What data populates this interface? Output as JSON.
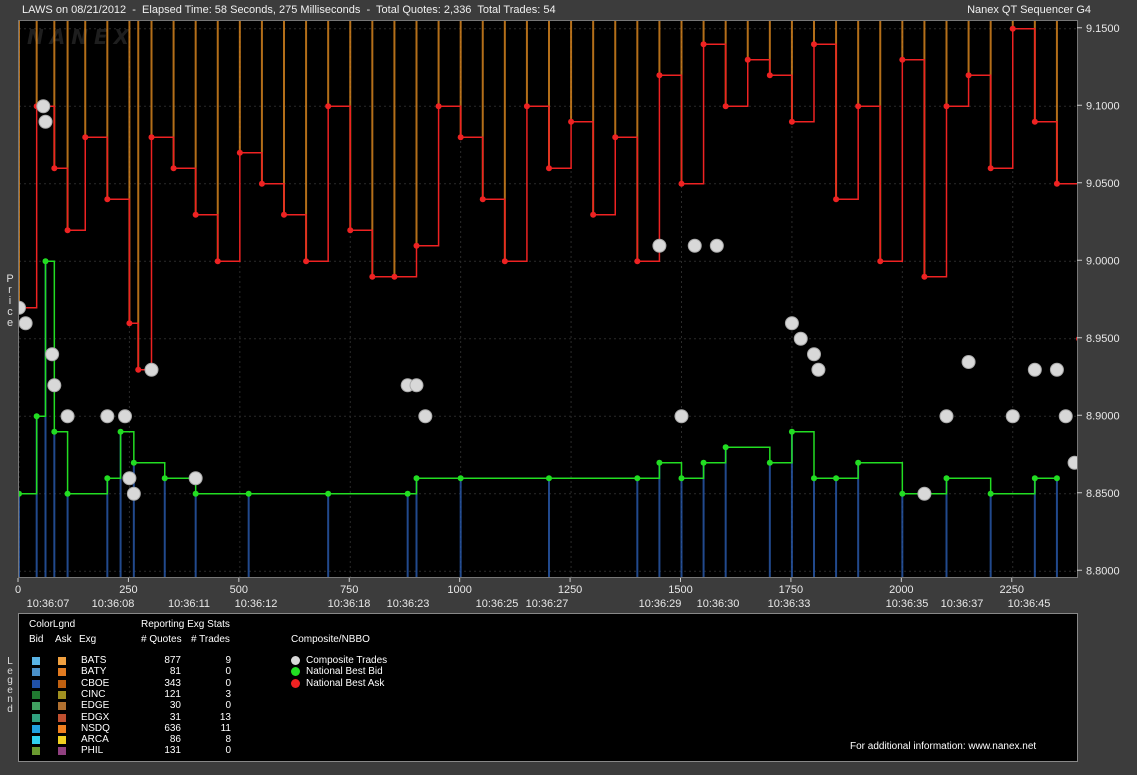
{
  "header": {
    "left": "LAWS on 08/21/2012  -  Elapsed Time: 58 Seconds, 275 Milliseconds  -  Total Quotes: 2,336  Total Trades: 54",
    "right": "Nanex QT Sequencer G4",
    "watermark": "NANEX"
  },
  "axis": {
    "vertical_label": "Price",
    "price_ticks": [
      "9.1500",
      "9.1000",
      "9.0500",
      "9.0000",
      "8.9500",
      "8.9000",
      "8.8500",
      "8.8000"
    ],
    "seq_ticks": [
      "0",
      "250",
      "500",
      "750",
      "1000",
      "1250",
      "1500",
      "1750",
      "2000",
      "2250"
    ],
    "time_ticks": [
      "10:36:07",
      "10:36:08",
      "10:36:11",
      "10:36:12",
      "10:36:18",
      "10:36:23",
      "10:36:25",
      "10:36:27",
      "10:36:29",
      "10:36:30",
      "10:36:33",
      "10:36:35",
      "10:36:37",
      "10:36:45"
    ]
  },
  "legend": {
    "vertical_label": "Legend",
    "color_legend_title": "ColorLgnd",
    "col_bid": "Bid",
    "col_ask": "Ask",
    "col_exg": "Exg",
    "stats_title": "Reporting Exg Stats",
    "col_quotes": "# Quotes",
    "col_trades": "# Trades",
    "composite_title": "Composite/NBBO",
    "composite_items": [
      {
        "label": "Composite Trades",
        "color": "#d8d8d8"
      },
      {
        "label": "National Best Bid",
        "color": "#22dd22"
      },
      {
        "label": "National Best Ask",
        "color": "#ee2222"
      }
    ],
    "exchanges": [
      {
        "name": "BATS",
        "bid_color": "#5ab4e6",
        "ask_color": "#f0a040",
        "quotes": "877",
        "trades": "9"
      },
      {
        "name": "BATY",
        "bid_color": "#4a90c8",
        "ask_color": "#e07a20",
        "quotes": "81",
        "trades": "0"
      },
      {
        "name": "CBOE",
        "bid_color": "#2050a8",
        "ask_color": "#c06010",
        "quotes": "343",
        "trades": "0"
      },
      {
        "name": "CINC",
        "bid_color": "#207a30",
        "ask_color": "#a09020",
        "quotes": "121",
        "trades": "3"
      },
      {
        "name": "EDGE",
        "bid_color": "#40a060",
        "ask_color": "#b07030",
        "quotes": "30",
        "trades": "0"
      },
      {
        "name": "EDGX",
        "bid_color": "#30a080",
        "ask_color": "#c05030",
        "quotes": "31",
        "trades": "13"
      },
      {
        "name": "NSDQ",
        "bid_color": "#20a0e0",
        "ask_color": "#f08020",
        "quotes": "636",
        "trades": "11"
      },
      {
        "name": "ARCA",
        "bid_color": "#30d0f0",
        "ask_color": "#f0d020",
        "quotes": "86",
        "trades": "8"
      },
      {
        "name": "PHIL",
        "bid_color": "#6a9a30",
        "ask_color": "#904080",
        "quotes": "131",
        "trades": "0"
      }
    ],
    "footer": "For additional information: www.nanex.net"
  },
  "chart_data": {
    "type": "line",
    "title": "LAWS on 08/21/2012",
    "ylabel": "Price",
    "xlabel": "",
    "ylim": [
      8.795,
      9.155
    ],
    "xlim": [
      0,
      2400
    ],
    "grid": true,
    "legend_placement": "bottom",
    "series": [
      {
        "name": "National Best Bid",
        "color": "#22dd22",
        "x": [
          0,
          40,
          60,
          80,
          110,
          200,
          230,
          260,
          330,
          400,
          520,
          700,
          880,
          900,
          1000,
          1200,
          1400,
          1450,
          1500,
          1550,
          1600,
          1700,
          1750,
          1800,
          1850,
          1900,
          2000,
          2100,
          2200,
          2300,
          2350
        ],
        "y": [
          8.85,
          8.9,
          9.0,
          8.89,
          8.85,
          8.86,
          8.89,
          8.87,
          8.86,
          8.85,
          8.85,
          8.85,
          8.85,
          8.86,
          8.86,
          8.86,
          8.86,
          8.87,
          8.86,
          8.87,
          8.88,
          8.87,
          8.89,
          8.86,
          8.86,
          8.87,
          8.85,
          8.86,
          8.85,
          8.86,
          8.86
        ]
      },
      {
        "name": "National Best Ask",
        "color": "#ee2222",
        "x": [
          0,
          40,
          80,
          110,
          150,
          200,
          250,
          270,
          300,
          350,
          400,
          450,
          500,
          550,
          600,
          650,
          700,
          750,
          800,
          850,
          900,
          950,
          1000,
          1050,
          1100,
          1150,
          1200,
          1250,
          1300,
          1350,
          1400,
          1450,
          1500,
          1550,
          1600,
          1650,
          1700,
          1750,
          1800,
          1850,
          1900,
          1950,
          2000,
          2050,
          2100,
          2150,
          2200,
          2250,
          2300,
          2350,
          2400
        ],
        "y": [
          8.97,
          9.1,
          9.06,
          9.02,
          9.08,
          9.04,
          8.96,
          8.93,
          9.08,
          9.06,
          9.03,
          9.0,
          9.07,
          9.05,
          9.03,
          9.0,
          9.1,
          9.02,
          8.99,
          8.99,
          9.01,
          9.1,
          9.08,
          9.04,
          9.0,
          9.1,
          9.06,
          9.09,
          9.03,
          9.08,
          9.0,
          9.12,
          9.05,
          9.14,
          9.1,
          9.13,
          9.12,
          9.09,
          9.14,
          9.04,
          9.1,
          9.0,
          9.13,
          8.99,
          9.1,
          9.12,
          9.06,
          9.15,
          9.09,
          9.05,
          8.95
        ]
      },
      {
        "name": "Composite Trades",
        "color": "#d8d8d8",
        "x": [
          0,
          15,
          55,
          60,
          75,
          80,
          110,
          200,
          240,
          250,
          260,
          300,
          400,
          880,
          900,
          920,
          1450,
          1500,
          1530,
          1580,
          1750,
          1770,
          1800,
          1810,
          2050,
          2100,
          2150,
          2250,
          2300,
          2350,
          2370,
          2390
        ],
        "y": [
          8.97,
          8.96,
          9.1,
          9.09,
          8.94,
          8.92,
          8.9,
          8.9,
          8.9,
          8.86,
          8.85,
          8.93,
          8.86,
          8.92,
          8.92,
          8.9,
          9.01,
          8.9,
          9.01,
          9.01,
          8.96,
          8.95,
          8.94,
          8.93,
          8.85,
          8.9,
          8.935,
          8.9,
          8.93,
          8.93,
          8.9,
          8.87
        ]
      }
    ]
  }
}
